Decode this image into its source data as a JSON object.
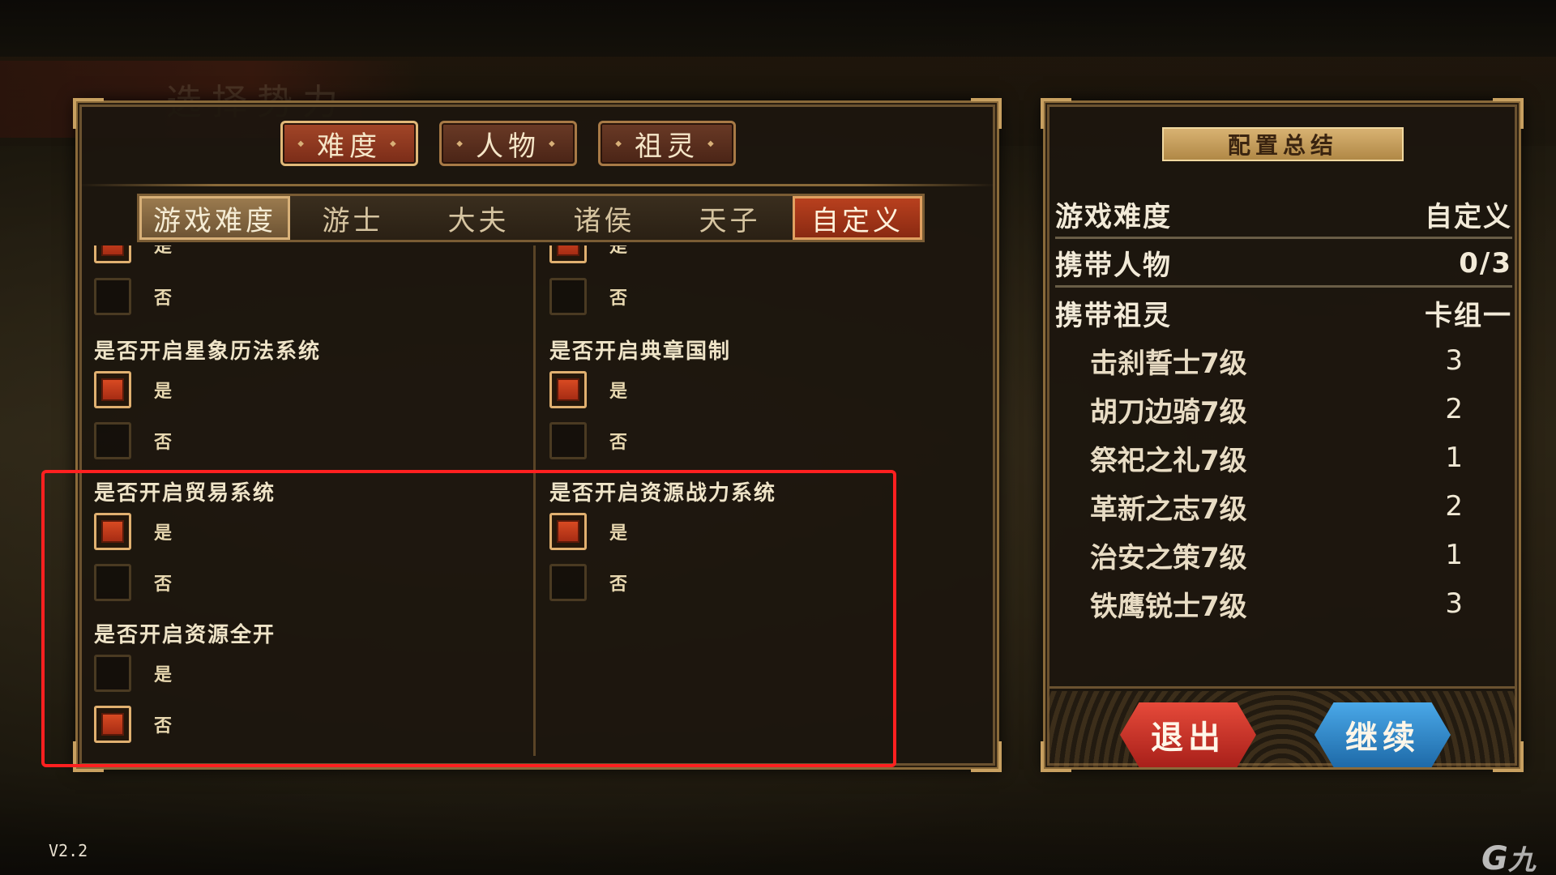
{
  "category_tabs": [
    {
      "label": "难度",
      "active": true
    },
    {
      "label": "人物",
      "active": false
    },
    {
      "label": "祖灵",
      "active": false
    }
  ],
  "difficulty_tabs": [
    "游戏难度",
    "游士",
    "大夫",
    "诸侯",
    "天子",
    "自定义"
  ],
  "options": {
    "left": [
      {
        "title": "",
        "yes_label": "是",
        "no_label": "否",
        "value": "yes"
      },
      {
        "title": "是否开启星象历法系统",
        "yes_label": "是",
        "no_label": "否",
        "value": "yes"
      },
      {
        "title": "是否开启贸易系统",
        "yes_label": "是",
        "no_label": "否",
        "value": "yes"
      },
      {
        "title": "是否开启资源全开",
        "yes_label": "是",
        "no_label": "否",
        "value": "no"
      }
    ],
    "right": [
      {
        "title": "",
        "yes_label": "是",
        "no_label": "否",
        "value": "yes"
      },
      {
        "title": "是否开启典章国制",
        "yes_label": "是",
        "no_label": "否",
        "value": "yes"
      },
      {
        "title": "是否开启资源战力系统",
        "yes_label": "是",
        "no_label": "否",
        "value": "yes"
      }
    ]
  },
  "summary": {
    "title": "配置总结",
    "rows": [
      {
        "key": "游戏难度",
        "value": "自定义"
      },
      {
        "key": "携带人物",
        "value": "0/3"
      },
      {
        "key": "携带祖灵",
        "value": "卡组一"
      }
    ],
    "cards": [
      {
        "name": "击刹誓士7级",
        "count": "3"
      },
      {
        "name": "胡刀边骑7级",
        "count": "2"
      },
      {
        "name": "祭祀之礼7级",
        "count": "1"
      },
      {
        "name": "革新之志7级",
        "count": "2"
      },
      {
        "name": "治安之策7级",
        "count": "1"
      },
      {
        "name": "铁鹰锐士7级",
        "count": "3"
      }
    ],
    "exit_label": "退出",
    "continue_label": "继续"
  },
  "background_title": "选择势力",
  "version": "V2.2",
  "watermark": "九游",
  "colors": {
    "accent_red": "#c03a1e",
    "gold": "#c8a060",
    "highlight": "#ff2020",
    "button_exit": "#d03a2a",
    "button_continue": "#2e88c8"
  }
}
